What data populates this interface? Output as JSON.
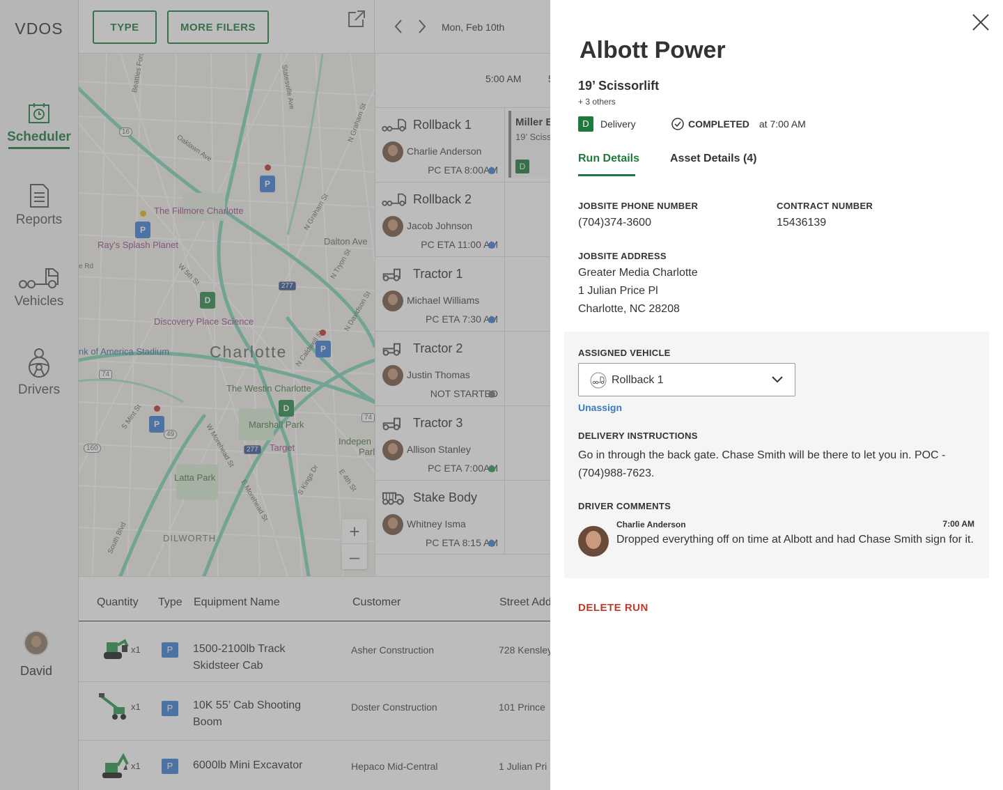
{
  "app": {
    "logo": "VDOS"
  },
  "sidebar": {
    "items": [
      {
        "label": "Scheduler",
        "icon": "calendar-clock-icon"
      },
      {
        "label": "Reports",
        "icon": "document-icon"
      },
      {
        "label": "Vehicles",
        "icon": "truck-icon"
      },
      {
        "label": "Drivers",
        "icon": "driver-steering-icon"
      }
    ],
    "user": {
      "name": "David"
    }
  },
  "topbar": {
    "type_label": "TYPE",
    "filters_label": "MORE FILERS",
    "prev_icon": "chevron-left-icon",
    "next_icon": "chevron-right-icon",
    "date": "Mon, Feb 10th"
  },
  "map": {
    "labels": {
      "fillmore": "The Fillmore Charlotte",
      "splash": "Ray's Splash Planet",
      "dalton": "Dalton Ave",
      "discovery": "Discovery Place Science",
      "stadium": "nk of America Stadium",
      "city": "Charlotte",
      "westin": "The Westin Charlotte",
      "marshall": "Marshall Park",
      "target": "Target",
      "independence": "Indepen",
      "independence2": "Parl",
      "latta": "Latta Park",
      "dilworth": "DILWORTH",
      "oaklawn": "Oaklawn Ave",
      "beatties": "Beatties Ford Rd",
      "statesville": "Statesville Ave",
      "graham": "N Graham St",
      "graham2": "N Graham St",
      "tryon": "N Tryon St",
      "davidson": "N Davidson St",
      "w5th": "W 5th St",
      "caldwell": "N Caldwell St",
      "mint": "S Mint St",
      "morehead": "W Morehead St",
      "emorehead": "E Morehead St",
      "skings": "S Kings Dr",
      "e4th": "E 4th St",
      "south": "South Blvd",
      "rd": "e Rd",
      "s16": "16",
      "s74": "74",
      "s160": "160",
      "s49": "49",
      "s277a": "277",
      "s277b": "277",
      "s74b": "74"
    },
    "zoom_in": "+",
    "zoom_out": "–"
  },
  "schedule": {
    "time1": "5:00 AM",
    "time2": "5",
    "rows": [
      {
        "vehicle": "Rollback 1",
        "driver": "Charlie Anderson",
        "eta": "PC ETA 8:00AM",
        "status_color": "#3f82d6"
      },
      {
        "vehicle": "Rollback 2",
        "driver": "Jacob Johnson",
        "eta": "PC ETA 11:00 AM",
        "status_color": "#3f82d6"
      },
      {
        "vehicle": "Tractor 1",
        "driver": "Michael Williams",
        "eta": "PC ETA 7:30 AM",
        "status_color": "#3f82d6"
      },
      {
        "vehicle": "Tractor 2",
        "driver": "Justin Thomas",
        "eta": "NOT STARTED",
        "status_color": "#777777"
      },
      {
        "vehicle": "Tractor 3",
        "driver": "Allison Stanley",
        "eta": "PC ETA 7:00AM",
        "status_color": "#2f9a55"
      },
      {
        "vehicle": "Stake Body",
        "driver": "Whitney Isma",
        "eta": "PC ETA 8:15 AM",
        "status_color": "#3f82d6"
      }
    ],
    "run_card": {
      "title": "Miller B",
      "sub": "19’ Sciss",
      "badge": "D"
    }
  },
  "table": {
    "headers": {
      "quantity": "Quantity",
      "type": "Type",
      "equipment": "Equipment Name",
      "customer": "Customer",
      "street": "Street Add"
    },
    "rows": [
      {
        "qty": "x1",
        "type": "P",
        "name": "1500-2100lb Track Skidsteer Cab",
        "customer": "Asher Construction",
        "street": "728 Kensley"
      },
      {
        "qty": "x1",
        "type": "P",
        "name": "10K 55’ Cab Shooting Boom",
        "customer": "Doster Construction",
        "street": "101 Prince"
      },
      {
        "qty": "x1",
        "type": "P",
        "name": "6000lb Mini Excavator",
        "customer": "Hepaco Mid-Central",
        "street": "1 Julian Pri"
      }
    ]
  },
  "panel": {
    "title": "Albott Power",
    "subtitle": "19’ Scissorlift",
    "others": "+ 3 others",
    "type_badge": "D",
    "type_label": "Delivery",
    "status": "COMPLETED",
    "status_time": "at 7:00 AM",
    "tabs": {
      "run": "Run Details",
      "asset": "Asset Details (4)"
    },
    "phone_label": "JOBSITE PHONE NUMBER",
    "phone": "(704)374-3600",
    "contract_label": "CONTRACT NUMBER",
    "contract": "15436139",
    "address_label": "JOBSITE ADDRESS",
    "address": {
      "line1": "Greater Media Charlotte",
      "line2": "1 Julian Price Pl",
      "line3": "Charlotte, NC 28208"
    },
    "vehicle_label": "ASSIGNED VEHICLE",
    "vehicle": "Rollback 1",
    "unassign": "Unassign",
    "instructions_label": "DELIVERY INSTRUCTIONS",
    "instructions": "Go in through the back gate. Chase Smith will be there to let you in. POC - (704)988-7623.",
    "comments_label": "DRIVER COMMENTS",
    "comment": {
      "author": "Charlie Anderson",
      "time": "7:00 AM",
      "text": "Dropped everything off on time at Albott and had Chase Smith sign for it."
    },
    "delete": "DELETE RUN"
  },
  "colors": {
    "brand": "#1e7a3c",
    "link": "#3a7bc8",
    "danger": "#c0392b",
    "pin": "#3f82d6"
  }
}
